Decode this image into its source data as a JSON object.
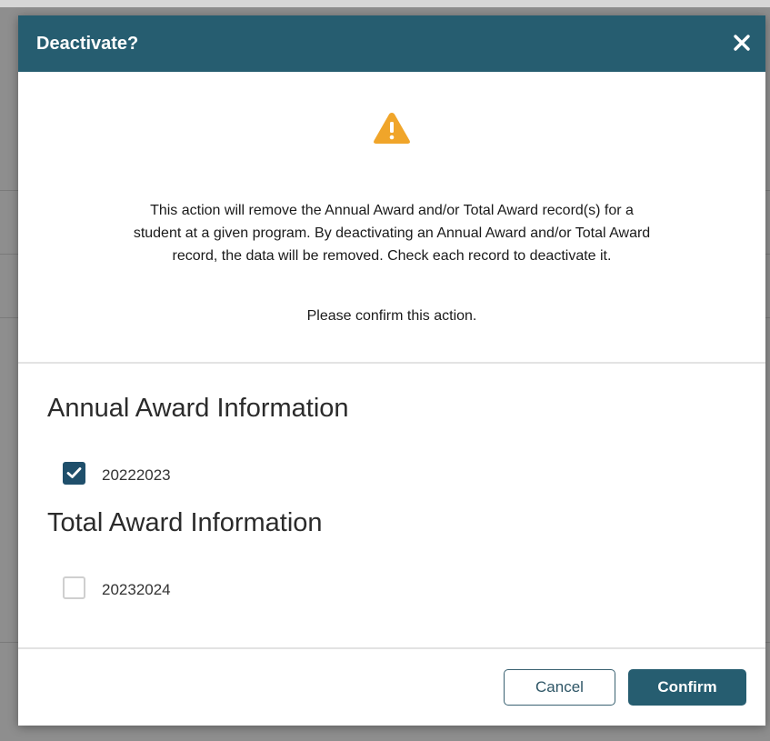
{
  "dialog": {
    "title": "Deactivate?",
    "close_icon": "close-icon",
    "warning_icon": "warning-icon",
    "message": "This action will remove the Annual Award and/or Total Award record(s) for a student at a given program. By deactivating an Annual Award and/or Total Award record, the data will be removed. Check each record to deactivate it.",
    "confirm_prompt": "Please confirm this action."
  },
  "annual_award": {
    "heading": "Annual Award Information",
    "records": [
      {
        "label": "20222023",
        "checked": true
      }
    ]
  },
  "total_award": {
    "heading": "Total Award Information",
    "records": [
      {
        "label": "20232024",
        "checked": false
      }
    ]
  },
  "footer": {
    "cancel_label": "Cancel",
    "confirm_label": "Confirm"
  },
  "colors": {
    "header_bg": "#265d70",
    "checkbox_checked": "#1f4f6b",
    "warning": "#f0a52a",
    "overlay": "#8e8e8e"
  }
}
